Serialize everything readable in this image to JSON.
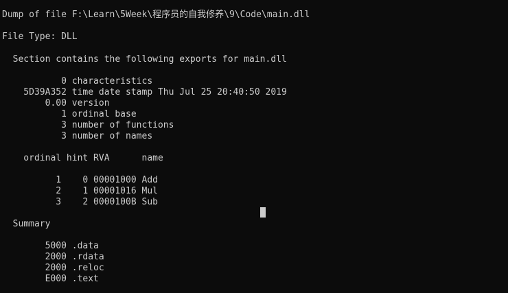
{
  "console": {
    "lines": [
      "Dump of file F:\\Learn\\5Week\\程序员的自我修养\\9\\Code\\main.dll",
      "File Type: DLL",
      "  Section contains the following exports for main.dll",
      "           0 characteristics",
      "    5D39A352 time date stamp Thu Jul 25 20:40:50 2019",
      "        0.00 version",
      "           1 ordinal base",
      "           3 number of functions",
      "           3 number of names",
      "    ordinal hint RVA      name",
      "          1    0 00001000 Add",
      "          2    1 00001016 Mul",
      "          3    2 0000100B Sub",
      "  Summary",
      "        5000 .data",
      "        2000 .rdata",
      "        2000 .reloc",
      "        E000 .text"
    ]
  }
}
